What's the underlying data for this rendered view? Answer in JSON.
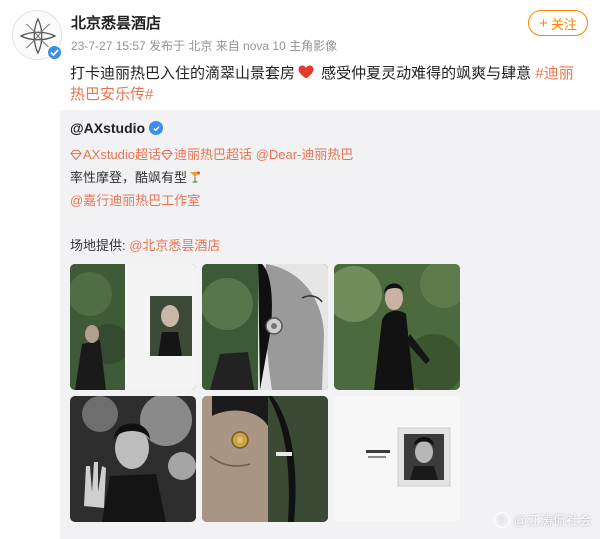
{
  "post": {
    "author": "北京悉昙酒店",
    "meta": "23-7-27 15:57 发布于 北京 来自 nova 10 主角影像",
    "follow_label": "关注",
    "text_before": "打卡迪丽热巴入住的滴翠山景套房",
    "text_after": " 感受仲夏灵动难得的飒爽与肆意 ",
    "hashtag": "#迪丽热巴安乐传#"
  },
  "repost": {
    "author": "@AXstudio",
    "topic_1": "AXstudio超话",
    "topic_2": "迪丽热巴超话",
    "mention_1": "@Dear-迪丽热巴",
    "line_2": "率性摩登，酷飒有型",
    "line_3": "@嘉行迪丽热巴工作室",
    "venue_label": "场地提供: ",
    "venue_mention": "@北京悉昙酒店"
  },
  "photos": [
    {
      "name": "photo-1-portrait-garden"
    },
    {
      "name": "photo-2-earring-closeup"
    },
    {
      "name": "photo-3-black-dress-garden"
    },
    {
      "name": "photo-4-hand-raised"
    },
    {
      "name": "photo-5-gold-earring"
    },
    {
      "name": "photo-6-framed-print"
    }
  ],
  "watermark": {
    "icon": "watermark-icon",
    "text": "@江涛侃社会"
  },
  "colors": {
    "accent": "#ff8200",
    "link": "#eb7350",
    "verified": "#3b8eea",
    "repost_bg": "#f2f2f5"
  }
}
